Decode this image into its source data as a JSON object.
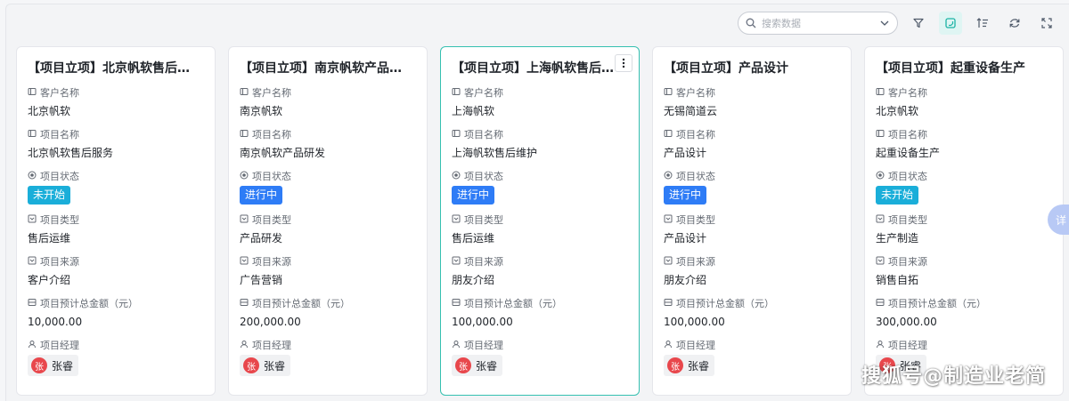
{
  "toolbar": {
    "search_placeholder": "搜索数据",
    "icons": [
      "search-icon",
      "chevron-down-icon",
      "filter-icon",
      "card-view-icon",
      "sort-icon",
      "refresh-icon",
      "fullscreen-icon"
    ]
  },
  "fields": {
    "customer": "客户名称",
    "project_name": "项目名称",
    "status": "项目状态",
    "type": "项目类型",
    "source": "项目来源",
    "budget": "项目预计总金额（元）",
    "manager": "项目经理"
  },
  "status_colors": {
    "未开始": "#1aaed9",
    "进行中": "#2e7cf6"
  },
  "cards": [
    {
      "title": "【项目立项】北京帆软售后服务",
      "customer": "北京帆软",
      "project_name": "北京帆软售后服务",
      "status": "未开始",
      "type": "售后运维",
      "source": "客户介绍",
      "budget": "10,000.00",
      "manager": "张睿",
      "avatar": "张"
    },
    {
      "title": "【项目立项】南京帆软产品研发",
      "customer": "南京帆软",
      "project_name": "南京帆软产品研发",
      "status": "进行中",
      "type": "产品研发",
      "source": "广告营销",
      "budget": "200,000.00",
      "manager": "张睿",
      "avatar": "张"
    },
    {
      "title": "【项目立项】上海帆软售后维护",
      "customer": "上海帆软",
      "project_name": "上海帆软售后维护",
      "status": "进行中",
      "type": "售后运维",
      "source": "朋友介绍",
      "budget": "100,000.00",
      "manager": "张睿",
      "avatar": "张"
    },
    {
      "title": "【项目立项】产品设计",
      "customer": "无锡简道云",
      "project_name": "产品设计",
      "status": "进行中",
      "type": "产品设计",
      "source": "朋友介绍",
      "budget": "100,000.00",
      "manager": "张睿",
      "avatar": "张"
    },
    {
      "title": "【项目立项】起重设备生产",
      "customer": "北京帆软",
      "project_name": "起重设备生产",
      "status": "未开始",
      "type": "生产制造",
      "source": "销售自拓",
      "budget": "300,000.00",
      "manager": "张睿",
      "avatar": "张"
    }
  ],
  "side_tab": "详",
  "watermark": "搜狐号@制造业老简"
}
